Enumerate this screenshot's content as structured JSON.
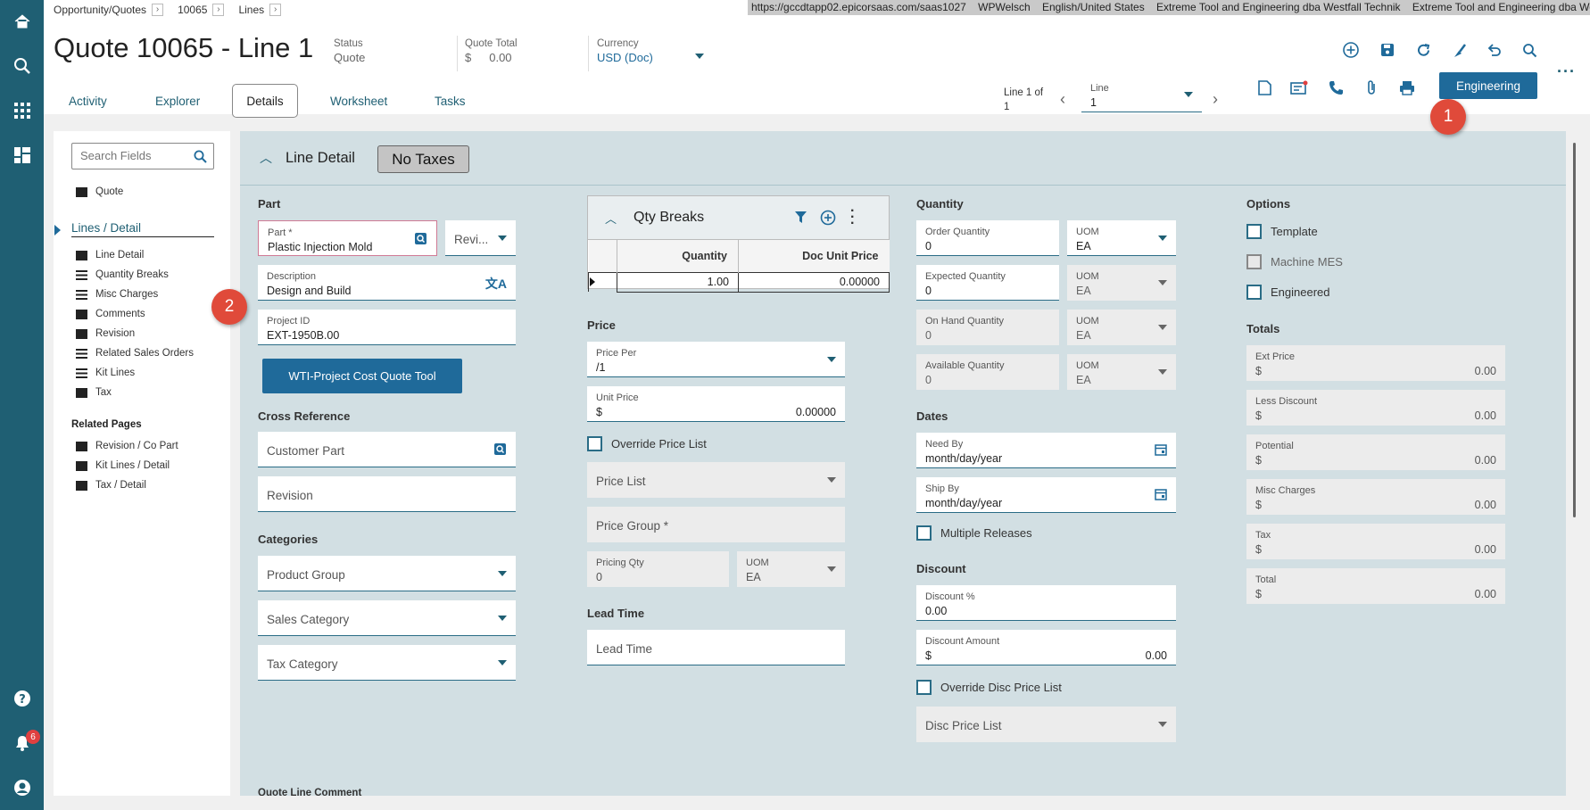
{
  "breadcrumb": {
    "items": [
      "Opportunity/Quotes",
      "10065",
      "Lines"
    ]
  },
  "url_bar": [
    "https://gccdtapp02.epicorsaas.com/saas1027",
    "WPWelsch",
    "English/United States",
    "Extreme Tool and Engineering dba Westfall Technik",
    "Extreme Tool and Engineering dba Westfall Technik"
  ],
  "header": {
    "title": "Quote 10065 - Line 1",
    "status_label": "Status",
    "status_value": "Quote",
    "quote_total_label": "Quote Total",
    "quote_total_currency": "$",
    "quote_total_value": "0.00",
    "currency_label": "Currency",
    "currency_value": "USD (Doc)"
  },
  "tabs": [
    "Activity",
    "Explorer",
    "Details",
    "Worksheet",
    "Tasks"
  ],
  "line_nav": {
    "label": "Line 1 of",
    "count": "1",
    "line_label": "Line",
    "line_value": "1"
  },
  "engineering_label": "Engineering",
  "callouts": [
    "1",
    "2"
  ],
  "left_nav": {
    "badge": "6"
  },
  "sidebar": {
    "search_placeholder": "Search Fields",
    "quote": "Quote",
    "section": "Lines / Detail",
    "items": [
      "Line Detail",
      "Quantity Breaks",
      "Misc Charges",
      "Comments",
      "Revision",
      "Related Sales Orders",
      "Kit Lines",
      "Tax"
    ],
    "related_title": "Related Pages",
    "related": [
      "Revision / Co Part",
      "Kit Lines / Detail",
      "Tax / Detail"
    ]
  },
  "line_detail": {
    "title": "Line Detail",
    "taxes_badge": "No Taxes",
    "part_section": "Part",
    "part_label": "Part *",
    "part_value": "Plastic Injection Mold",
    "revision_short": "Revi...",
    "description_label": "Description",
    "description_value": "Design and Build",
    "project_label": "Project ID",
    "project_value": "EXT-1950B.00",
    "tool_button": "WTI-Project Cost Quote Tool",
    "crossref_section": "Cross Reference",
    "customer_part": "Customer Part",
    "revision": "Revision",
    "categories_section": "Categories",
    "product_group": "Product Group",
    "sales_category": "Sales Category",
    "tax_category": "Tax Category",
    "comment_section": "Quote Line Comment"
  },
  "qty_breaks": {
    "title": "Qty Breaks",
    "columns": [
      "Quantity",
      "Doc Unit Price"
    ],
    "rows": [
      [
        "1.00",
        "0.00000"
      ]
    ]
  },
  "price": {
    "section": "Price",
    "price_per_label": "Price Per",
    "price_per_value": "/1",
    "unit_price_label": "Unit Price",
    "unit_price_currency": "$",
    "unit_price_value": "0.00000",
    "override_label": "Override Price List",
    "price_list": "Price List",
    "price_group": "Price Group *",
    "pricing_qty_label": "Pricing Qty",
    "pricing_qty_value": "0",
    "uom_label": "UOM",
    "uom_value": "EA",
    "lead_section": "Lead Time",
    "lead_time": "Lead Time"
  },
  "quantity": {
    "section": "Quantity",
    "rows": [
      {
        "label": "Order Quantity",
        "value": "0",
        "uom": "EA"
      },
      {
        "label": "Expected Quantity",
        "value": "0",
        "uom": "EA"
      },
      {
        "label": "On Hand Quantity",
        "value": "0",
        "uom": "EA"
      },
      {
        "label": "Available Quantity",
        "value": "0",
        "uom": "EA"
      }
    ],
    "uom_label": "UOM"
  },
  "dates": {
    "section": "Dates",
    "need_by_label": "Need By",
    "need_by_value": "month/day/year",
    "ship_by_label": "Ship By",
    "ship_by_value": "month/day/year",
    "multiple_releases": "Multiple Releases"
  },
  "discount": {
    "section": "Discount",
    "pct_label": "Discount %",
    "pct_value": "0.00",
    "amount_label": "Discount Amount",
    "amount_currency": "$",
    "amount_value": "0.00",
    "override_label": "Override Disc Price List",
    "disc_price_list": "Disc Price List"
  },
  "options": {
    "section": "Options",
    "template": "Template",
    "machine_mes": "Machine MES",
    "engineered": "Engineered"
  },
  "totals": {
    "section": "Totals",
    "items": [
      {
        "label": "Ext Price",
        "currency": "$",
        "value": "0.00"
      },
      {
        "label": "Less Discount",
        "currency": "$",
        "value": "0.00"
      },
      {
        "label": "Potential",
        "currency": "$",
        "value": "0.00"
      },
      {
        "label": "Misc Charges",
        "currency": "$",
        "value": "0.00"
      },
      {
        "label": "Tax",
        "currency": "$",
        "value": "0.00"
      },
      {
        "label": "Total",
        "currency": "$",
        "value": "0.00"
      }
    ]
  }
}
